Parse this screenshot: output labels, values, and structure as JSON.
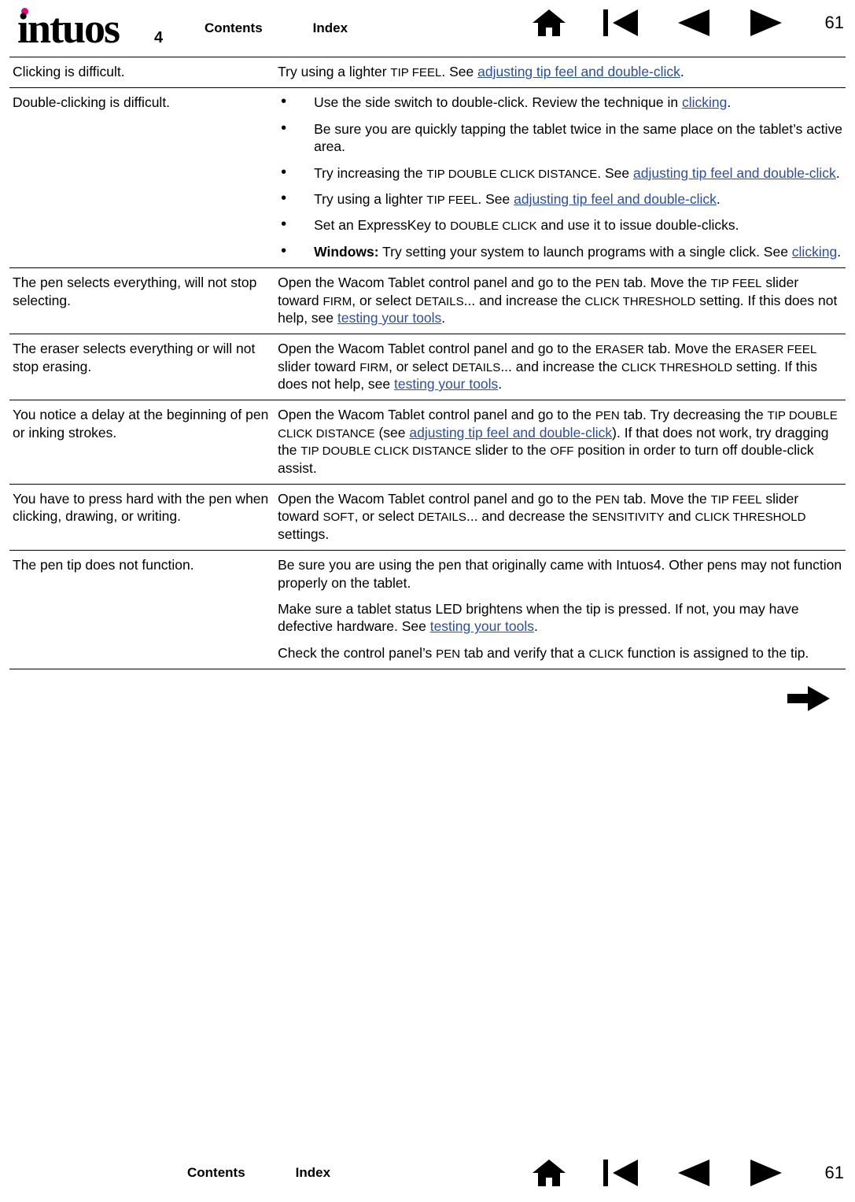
{
  "header": {
    "logo_text": "intuos",
    "logo_sub": "4",
    "contents_label": "Contents",
    "index_label": "Index",
    "page_number": "61",
    "icons": [
      "home-icon",
      "back-icon",
      "previous-page-icon",
      "next-page-icon"
    ]
  },
  "footer": {
    "contents_label": "Contents",
    "index_label": "Index",
    "page_number": "61",
    "icons": [
      "home-icon",
      "back-icon",
      "previous-page-icon",
      "next-page-icon"
    ]
  },
  "next_arrow": "next-page-arrow-icon",
  "rows": [
    {
      "problem": "Clicking is difficult.",
      "solution_html": "Try using a lighter <span class=\"sc\">Tip Feel</span>.  See <span class=\"lnk\">adjusting tip feel and double-click</span>."
    },
    {
      "problem": "Double-clicking is difficult.",
      "solution_html": "<ul class=\"bullets\"><li>Use the side switch to double-click.  Review the technique in <span class=\"lnk\">clicking</span>.</li><li>Be sure you are quickly tapping the tablet twice in the same place on the tablet’s active area.</li><li>Try increasing the <span class=\"sc\">Tip Double Click Distance</span>.  See <span class=\"lnk\">adjusting tip feel and double-click</span>.</li><li>Try using a lighter <span class=\"sc\">Tip Feel</span>.  See <span class=\"lnk\">adjusting tip feel and double-click</span>.</li><li>Set an ExpressKey to <span class=\"sc\">Double Click</span> and use it to issue double-clicks.</li><li><span class=\"bold\">Windows:</span> Try setting your system to launch programs with a single click.  See <span class=\"lnk\">clicking</span>.</li></ul>"
    },
    {
      "problem": "The pen selects everything, will not stop selecting.",
      "solution_html": "Open the Wacom Tablet control panel and go to the <span class=\"sc\">Pen</span> tab.  Move the <span class=\"sc\">Tip Feel</span> slider toward <span class=\"sc\">Firm</span>, or select <span class=\"sc\">Details</span>... and increase the <span class=\"sc\">Click Threshold</span> setting.  If this does not help, see <span class=\"lnk\">testing your tools</span>."
    },
    {
      "problem": "The eraser selects everything or will not stop erasing.",
      "solution_html": "Open the Wacom Tablet control panel and go to the <span class=\"sc\">Eraser</span> tab.  Move the <span class=\"sc\">Eraser Feel</span> slider toward <span class=\"sc\">Firm</span>, or select <span class=\"sc\">Details</span>... and increase the <span class=\"sc\">Click Threshold</span> setting.  If this does not help, see <span class=\"lnk\">testing your tools</span>."
    },
    {
      "problem": "You notice a delay at the beginning of pen or inking strokes.",
      "solution_html": "Open the Wacom Tablet control panel and go to the <span class=\"sc\">Pen</span> tab.  Try decreasing the <span class=\"sc\">Tip Double Click Distance</span> (see <span class=\"lnk\">adjusting tip feel and double-click</span>).  If that does not work, try dragging the <span class=\"sc\">Tip Double Click Distance</span> slider to the <span class=\"sc\">Off</span> position in order to turn off double-click assist."
    },
    {
      "problem": "You have to press hard with the pen when clicking, drawing, or writing.",
      "solution_html": "Open the Wacom Tablet control panel and go to the <span class=\"sc\">Pen</span> tab.  Move the <span class=\"sc\">Tip Feel</span> slider toward <span class=\"sc\">Soft</span>, or select <span class=\"sc\">Details</span>... and decrease the <span class=\"sc\">Sensitivity</span> and <span class=\"sc\">Click Threshold</span> settings."
    },
    {
      "problem": "The pen tip does not function.",
      "solution_html": "<p class=\"para\">Be sure you are using the pen that originally came with Intuos4.  Other pens may not function properly on the tablet.</p><p class=\"para\">Make sure a tablet status LED brightens when the tip is pressed.  If not, you may have defective hardware.  See <span class=\"lnk\">testing your tools</span>.</p><p class=\"para\">Check the control panel’s <span class=\"sc\">Pen</span> tab and verify that a <span class=\"sc\">Click</span> function is assigned to the tip.</p>"
    }
  ]
}
